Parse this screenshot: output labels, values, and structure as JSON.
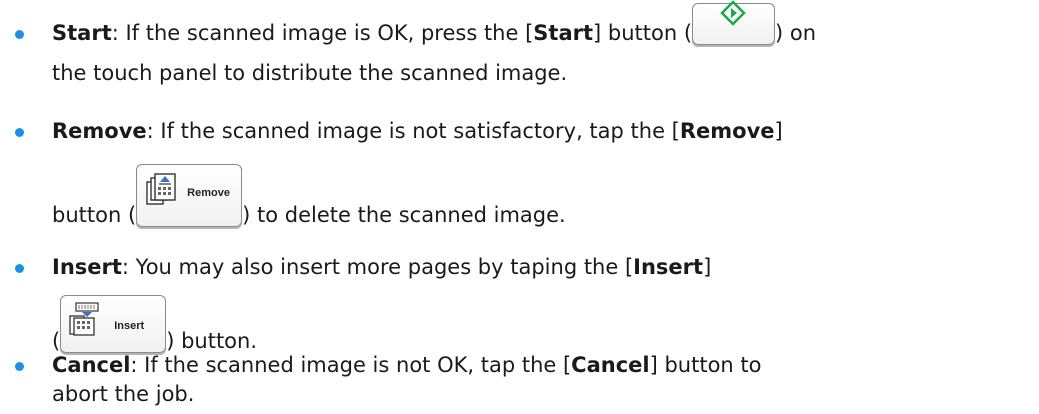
{
  "items": [
    {
      "term": "Start",
      "line1_a": ": If the scanned image is OK, press the [",
      "line1_b": "] button (",
      "line1_c": ") on",
      "line2": "the touch panel to distribute the scanned image."
    },
    {
      "term": "Remove",
      "line1_a": ": If the scanned image is not satisfactory, tap the [",
      "line1_b": "]",
      "line2_a": "button (",
      "line2_b": ") to delete the scanned image.",
      "button_label": "Remove"
    },
    {
      "term": "Insert",
      "line1_a": ": You may also insert more pages by taping the [",
      "line1_b": "]",
      "line2_a": "(",
      "line2_b": ") button.",
      "button_label": "Insert"
    },
    {
      "term": "Cancel",
      "line1_a": ": If the scanned image is not OK, tap the [",
      "line1_b": "] button to",
      "line2": "abort the job."
    }
  ],
  "colors": {
    "bullet": "#1f8fe5",
    "start_icon": "#1aa84a"
  }
}
